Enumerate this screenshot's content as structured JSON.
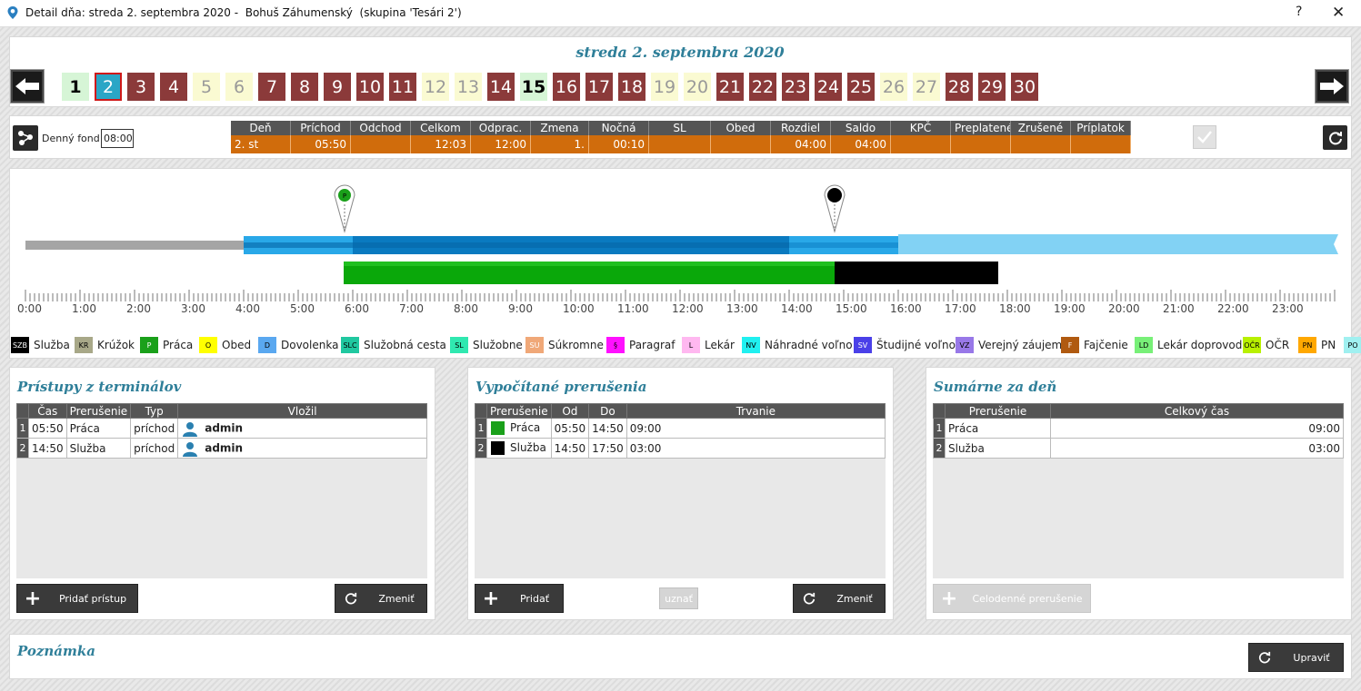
{
  "window": {
    "title": "Detail dňa: streda 2. septembra 2020 -  Bohuš Záhumenský  (skupina 'Tesári 2')",
    "help": "?",
    "close": "✕"
  },
  "header": {
    "date_title": "streda 2. septembra 2020"
  },
  "days": [
    {
      "n": "1",
      "type": "g"
    },
    {
      "n": "2",
      "type": "s"
    },
    {
      "n": "3",
      "type": "w"
    },
    {
      "n": "4",
      "type": "w"
    },
    {
      "n": "5",
      "type": "o"
    },
    {
      "n": "6",
      "type": "o"
    },
    {
      "n": "7",
      "type": "w"
    },
    {
      "n": "8",
      "type": "w"
    },
    {
      "n": "9",
      "type": "w"
    },
    {
      "n": "10",
      "type": "w"
    },
    {
      "n": "11",
      "type": "w"
    },
    {
      "n": "12",
      "type": "o"
    },
    {
      "n": "13",
      "type": "o"
    },
    {
      "n": "14",
      "type": "w"
    },
    {
      "n": "15",
      "type": "g"
    },
    {
      "n": "16",
      "type": "w"
    },
    {
      "n": "17",
      "type": "w"
    },
    {
      "n": "18",
      "type": "w"
    },
    {
      "n": "19",
      "type": "o"
    },
    {
      "n": "20",
      "type": "o"
    },
    {
      "n": "21",
      "type": "w"
    },
    {
      "n": "22",
      "type": "w"
    },
    {
      "n": "23",
      "type": "w"
    },
    {
      "n": "24",
      "type": "w"
    },
    {
      "n": "25",
      "type": "w"
    },
    {
      "n": "26",
      "type": "o"
    },
    {
      "n": "27",
      "type": "o"
    },
    {
      "n": "28",
      "type": "w"
    },
    {
      "n": "29",
      "type": "w"
    },
    {
      "n": "30",
      "type": "w"
    }
  ],
  "fond": {
    "label": "Denný fond:",
    "value": "08:00"
  },
  "summary": {
    "headers": [
      "Deň",
      "Príchod",
      "Odchod",
      "Celkom",
      "Odprac.",
      "Zmena",
      "Nočná",
      "SL",
      "Obed",
      "Rozdiel",
      "Saldo",
      "KPČ",
      "Preplatené",
      "Zrušené",
      "Príplatok"
    ],
    "row": [
      "2. st",
      "05:50",
      "",
      "12:03",
      "12:00",
      "1.",
      "00:10",
      "",
      "",
      "04:00",
      "04:00",
      "",
      "",
      "",
      ""
    ]
  },
  "timeline": {
    "hours": [
      "0:00",
      "1:00",
      "2:00",
      "3:00",
      "4:00",
      "5:00",
      "6:00",
      "7:00",
      "8:00",
      "9:00",
      "10:00",
      "11:00",
      "12:00",
      "13:00",
      "14:00",
      "15:00",
      "16:00",
      "17:00",
      "18:00",
      "19:00",
      "20:00",
      "21:00",
      "22:00",
      "23:00"
    ],
    "pin1_letter": "P"
  },
  "legend": [
    {
      "code": "SZB",
      "label": "Služba",
      "bg": "#000000",
      "fg": "#ffffff"
    },
    {
      "code": "KR",
      "label": "Krúžok",
      "bg": "#a8a888",
      "fg": "#000"
    },
    {
      "code": "P",
      "label": "Práca",
      "bg": "#1aa01a",
      "fg": "#fff"
    },
    {
      "code": "O",
      "label": "Obed",
      "bg": "#ffff00",
      "fg": "#000"
    },
    {
      "code": "D",
      "label": "Dovolenka",
      "bg": "#5aa8f0",
      "fg": "#000"
    },
    {
      "code": "SLC",
      "label": "Služobná cesta",
      "bg": "#20c8a0",
      "fg": "#000"
    },
    {
      "code": "SL",
      "label": "Služobne",
      "bg": "#30e8b0",
      "fg": "#000"
    },
    {
      "code": "SU",
      "label": "Súkromne",
      "bg": "#f0a878",
      "fg": "#fff"
    },
    {
      "code": "§",
      "label": "Paragraf",
      "bg": "#ff10ff",
      "fg": "#000"
    },
    {
      "code": "L",
      "label": "Lekár",
      "bg": "#ffb8f0",
      "fg": "#000"
    },
    {
      "code": "NV",
      "label": "Náhradné voľno",
      "bg": "#20f0f0",
      "fg": "#000"
    },
    {
      "code": "SV",
      "label": "Študijné voľno",
      "bg": "#4a40e8",
      "fg": "#fff"
    },
    {
      "code": "VZ",
      "label": "Verejný záujem",
      "bg": "#9878e8",
      "fg": "#000"
    },
    {
      "code": "F",
      "label": "Fajčenie",
      "bg": "#b05a10",
      "fg": "#fff"
    },
    {
      "code": "LD",
      "label": "Lekár doprovod",
      "bg": "#78f078",
      "fg": "#000"
    },
    {
      "code": "OČR",
      "label": "OČR",
      "bg": "#b8f000",
      "fg": "#000"
    },
    {
      "code": "PN",
      "label": "PN",
      "bg": "#ffa800",
      "fg": "#000"
    },
    {
      "code": "PO",
      "label": "",
      "bg": "#a0f0f0",
      "fg": "#000"
    }
  ],
  "access": {
    "title": "Prístupy z terminálov",
    "headers": [
      "Čas",
      "Prerušenie",
      "Typ",
      "Vložil"
    ],
    "rows": [
      {
        "n": "1",
        "time": "05:50",
        "type": "Práca",
        "kind": "príchod",
        "user": "admin"
      },
      {
        "n": "2",
        "time": "14:50",
        "type": "Služba",
        "kind": "príchod",
        "user": "admin"
      }
    ],
    "add_label": "Pridať prístup",
    "change_label": "Zmeniť"
  },
  "breaks": {
    "title": "Vypočítané prerušenia",
    "headers": [
      "Prerušenie",
      "Od",
      "Do",
      "Trvanie"
    ],
    "rows": [
      {
        "n": "1",
        "color": "#1aa01a",
        "name": "Práca",
        "from": "05:50",
        "to": "14:50",
        "dur": "09:00"
      },
      {
        "n": "2",
        "color": "#000000",
        "name": "Služba",
        "from": "14:50",
        "to": "17:50",
        "dur": "03:00"
      }
    ],
    "add_label": "Pridať",
    "accept_label": "uznať",
    "change_label": "Zmeniť"
  },
  "totals": {
    "title": "Sumárne za deň",
    "headers": [
      "Prerušenie",
      "Celkový čas"
    ],
    "rows": [
      {
        "n": "1",
        "name": "Práca",
        "total": "09:00"
      },
      {
        "n": "2",
        "name": "Služba",
        "total": "03:00"
      }
    ],
    "fullday_label": "Celodenné prerušenie"
  },
  "note": {
    "title": "Poznámka",
    "edit_label": "Upraviť"
  }
}
